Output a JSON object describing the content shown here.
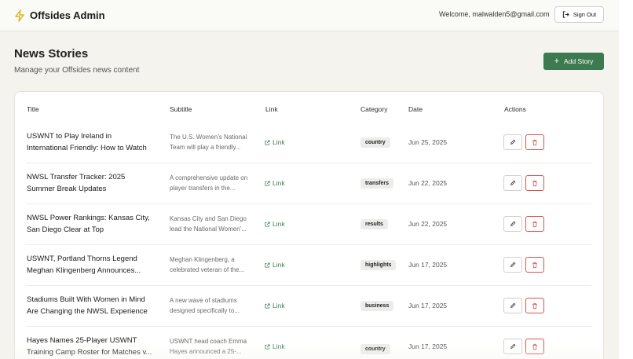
{
  "header": {
    "app_title": "Offsides Admin",
    "welcome_text": "Welcome, malwalden5@gmail.com",
    "signout_label": "Sign Out"
  },
  "page": {
    "title": "News Stories",
    "subtitle": "Manage your Offsides news content",
    "add_label": "Add Story"
  },
  "table": {
    "columns": {
      "title": "Title",
      "subtitle": "Subtitle",
      "link": "Link",
      "category": "Category",
      "date": "Date",
      "actions": "Actions"
    },
    "rows": [
      {
        "title_1": "USWNT to Play Ireland in",
        "title_2": "International Friendly: How to Watch",
        "sub_1": "The U.S. Women's National",
        "sub_2": "Team will play a friendly...",
        "link": "Link",
        "category": "country",
        "date": "Jun 25, 2025"
      },
      {
        "title_1": "NWSL Transfer Tracker: 2025",
        "title_2": "Summer Break Updates",
        "sub_1": "A comprehensive update on",
        "sub_2": "player transfers in the...",
        "link": "Link",
        "category": "transfers",
        "date": "Jun 22, 2025"
      },
      {
        "title_1": "NWSL Power Rankings: Kansas City,",
        "title_2": "San Diego Clear at Top",
        "sub_1": "Kansas City and San Diego",
        "sub_2": "lead the National Women'...",
        "link": "Link",
        "category": "results",
        "date": "Jun 22, 2025"
      },
      {
        "title_1": "USWNT, Portland Thorns Legend",
        "title_2": "Meghan Klingenberg Announces...",
        "sub_1": "Meghan Klingenberg, a",
        "sub_2": "celebrated veteran of the...",
        "link": "Link",
        "category": "highlights",
        "date": "Jun 17, 2025"
      },
      {
        "title_1": "Stadiums Built With Women in Mind",
        "title_2": "Are Changing the NWSL Experience",
        "sub_1": "A new wave of stadiums",
        "sub_2": "designed specifically to...",
        "link": "Link",
        "category": "business",
        "date": "Jun 17, 2025"
      },
      {
        "title_1": "Hayes Names 25-Player USWNT",
        "title_2": "Training Camp Roster for Matches v...",
        "sub_1": "USWNT head coach Emma",
        "sub_2": "Hayes announced a 25-...",
        "link": "Link",
        "category": "country",
        "date": "Jun 17, 2025"
      }
    ]
  },
  "icons": {
    "brand": "lightning-icon",
    "signout": "logout-icon",
    "add": "plus-icon",
    "link": "external-link-icon",
    "edit": "pencil-icon",
    "delete": "trash-icon"
  },
  "colors": {
    "accent_green": "#3d7a4f",
    "brand_yellow": "#e0b21a",
    "delete_red": "#d9534f",
    "background": "#f4f3ee"
  }
}
